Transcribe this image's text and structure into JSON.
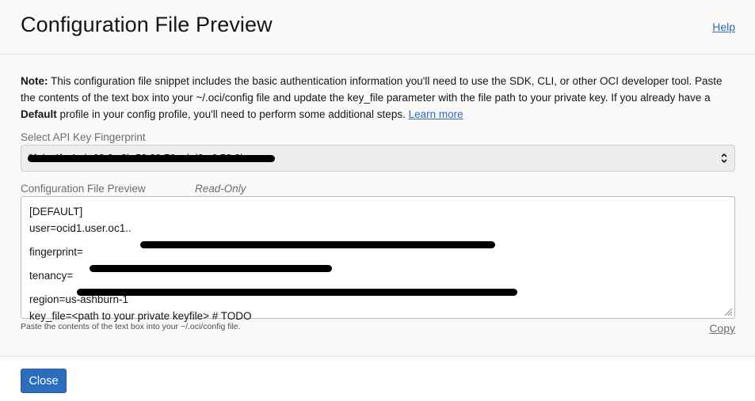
{
  "dialog": {
    "title": "Configuration File Preview",
    "help_link": "Help"
  },
  "note": {
    "label": "Note:",
    "text_1": " This configuration file snippet includes the basic authentication information you'll need to use the SDK, CLI, or other OCI developer tool. Paste the contents of the text box into your ~/.oci/config file and update the key_file parameter with the file path to your private key. If you already have a ",
    "bold_word": "Default",
    "text_2": " profile in your config profile, you'll need to perform some additional steps. ",
    "learn_more": "Learn more"
  },
  "fingerprint_select": {
    "label": "Select API Key Fingerprint",
    "selected_value": "6f:da:4f:c4:ab:62:2c:2b:53:39:76:cd:d8:c6:58:2b"
  },
  "preview": {
    "label": "Configuration File Preview",
    "readonly_tag": "Read-Only",
    "lines": {
      "section": "[DEFAULT]",
      "user_prefix": "user=ocid1.user.oc1..",
      "fingerprint_prefix": "fingerprint=",
      "tenancy_prefix": "tenancy=",
      "region": "region=us-ashburn-1",
      "key_file": "key_file=<path to your private keyfile> # TODO"
    },
    "hint": "Paste the contents of the text box into your ~/.oci/config file.",
    "copy_link": "Copy"
  },
  "footer": {
    "close_label": "Close"
  },
  "colors": {
    "link": "#2e6cbf",
    "primary_button": "#2c6dbd",
    "panel_background": "#fbf9f8"
  }
}
